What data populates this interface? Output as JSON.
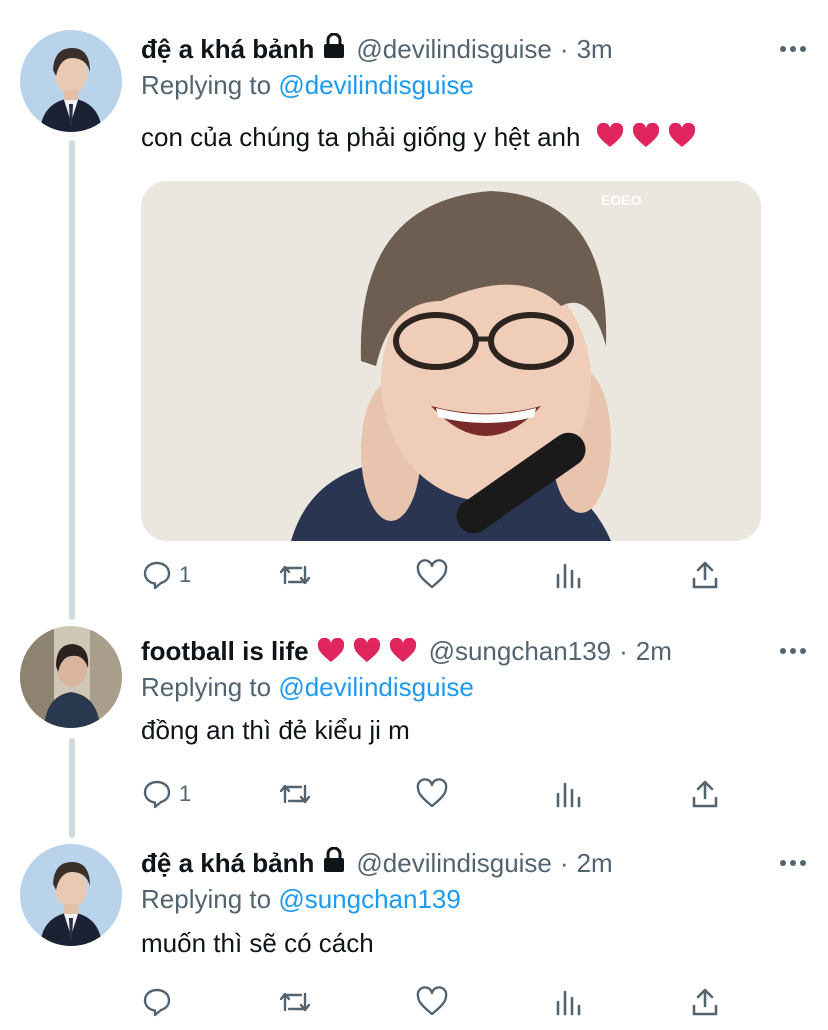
{
  "colors": {
    "link": "#1d9bf0",
    "muted": "#536471",
    "heart": "#e0245e",
    "line": "#cfd9de"
  },
  "tweets": [
    {
      "display_name": "đệ a khá bảnh",
      "locked": true,
      "handle": "@devilindisguise",
      "time": "3m",
      "reply_prefix": "Replying to",
      "reply_to": "@devilindisguise",
      "text": "con của chúng ta phải giống y hệt anh",
      "text_emoji": [
        "heart",
        "heart",
        "heart"
      ],
      "media_logo": "EOEO",
      "reply_count": "1",
      "retweet_count": "",
      "like_count": ""
    },
    {
      "display_name": "football is life",
      "name_emoji": [
        "heart",
        "heart",
        "heart"
      ],
      "handle": "@sungchan139",
      "time": "2m",
      "reply_prefix": "Replying to",
      "reply_to": "@devilindisguise",
      "text": "đồng an thì đẻ kiểu ji m",
      "reply_count": "1",
      "retweet_count": "",
      "like_count": ""
    },
    {
      "display_name": "đệ a khá bảnh",
      "locked": true,
      "handle": "@devilindisguise",
      "time": "2m",
      "reply_prefix": "Replying to",
      "reply_to": "@sungchan139",
      "text": "muốn thì sẽ có cách",
      "reply_count": "",
      "retweet_count": "",
      "like_count": ""
    }
  ],
  "dot_separator": "·"
}
